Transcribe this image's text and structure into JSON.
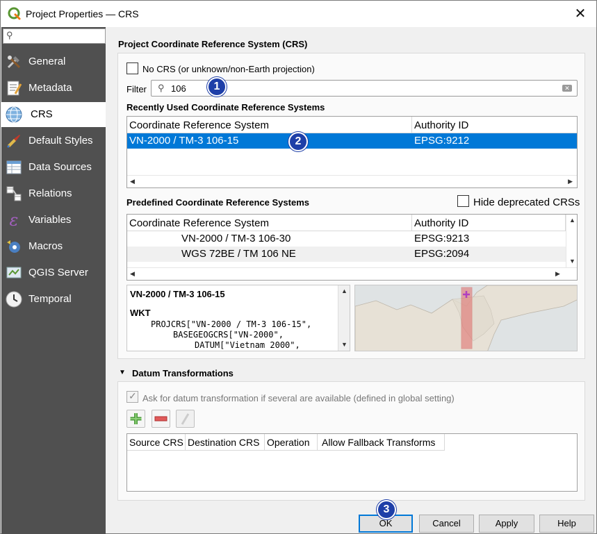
{
  "window": {
    "title": "Project Properties — CRS",
    "close_label": "✕"
  },
  "sidebar": {
    "search_placeholder": "",
    "items": [
      {
        "label": "General",
        "icon": "wrench-hammer-icon"
      },
      {
        "label": "Metadata",
        "icon": "metadata-icon"
      },
      {
        "label": "CRS",
        "icon": "globe-icon"
      },
      {
        "label": "Default Styles",
        "icon": "paintbrush-icon"
      },
      {
        "label": "Data Sources",
        "icon": "data-sources-icon"
      },
      {
        "label": "Relations",
        "icon": "relations-icon"
      },
      {
        "label": "Variables",
        "icon": "variables-icon"
      },
      {
        "label": "Macros",
        "icon": "macros-icon"
      },
      {
        "label": "QGIS Server",
        "icon": "qgis-server-icon"
      },
      {
        "label": "Temporal",
        "icon": "clock-icon"
      }
    ],
    "active_index": 2
  },
  "crs": {
    "section_title": "Project Coordinate Reference System (CRS)",
    "no_crs_label": "No CRS (or unknown/non-Earth projection)",
    "no_crs_checked": false,
    "filter_label": "Filter",
    "filter_value": "106",
    "recent_title": "Recently Used Coordinate Reference Systems",
    "columns": [
      "Coordinate Reference System",
      "Authority ID"
    ],
    "recent_rows": [
      {
        "name": "VN-2000 / TM-3 106-15",
        "authority": "EPSG:9212",
        "selected": true
      }
    ],
    "predefined_title": "Predefined Coordinate Reference Systems",
    "hide_deprecated_label": "Hide deprecated CRSs",
    "hide_deprecated_checked": false,
    "predefined_rows": [
      {
        "name": "VN-2000 / TM-3 106-30",
        "authority": "EPSG:9213"
      },
      {
        "name": "WGS 72BE / TM 106 NE",
        "authority": "EPSG:2094"
      }
    ],
    "details": {
      "title": "VN-2000 / TM-3 106-15",
      "wkt_heading": "WKT",
      "wkt_lines": [
        "PROJCRS[\"VN-2000 / TM-3 106-15\",",
        "BASEGEOGCRS[\"VN-2000\",",
        "DATUM[\"Vietnam 2000\","
      ]
    }
  },
  "datum": {
    "section_title": "Datum Transformations",
    "ask_label": "Ask for datum transformation if several are available (defined in global setting)",
    "ask_checked": true,
    "columns": [
      "Source CRS",
      "Destination CRS",
      "Operation",
      "Allow Fallback Transforms"
    ]
  },
  "badges": [
    "1",
    "2",
    "3"
  ],
  "buttons": {
    "ok": "OK",
    "cancel": "Cancel",
    "apply": "Apply",
    "help": "Help"
  },
  "colors": {
    "selection": "#0078d7",
    "sidebar": "#505050",
    "badge": "#1e3fa8",
    "extent": "#e05050"
  }
}
